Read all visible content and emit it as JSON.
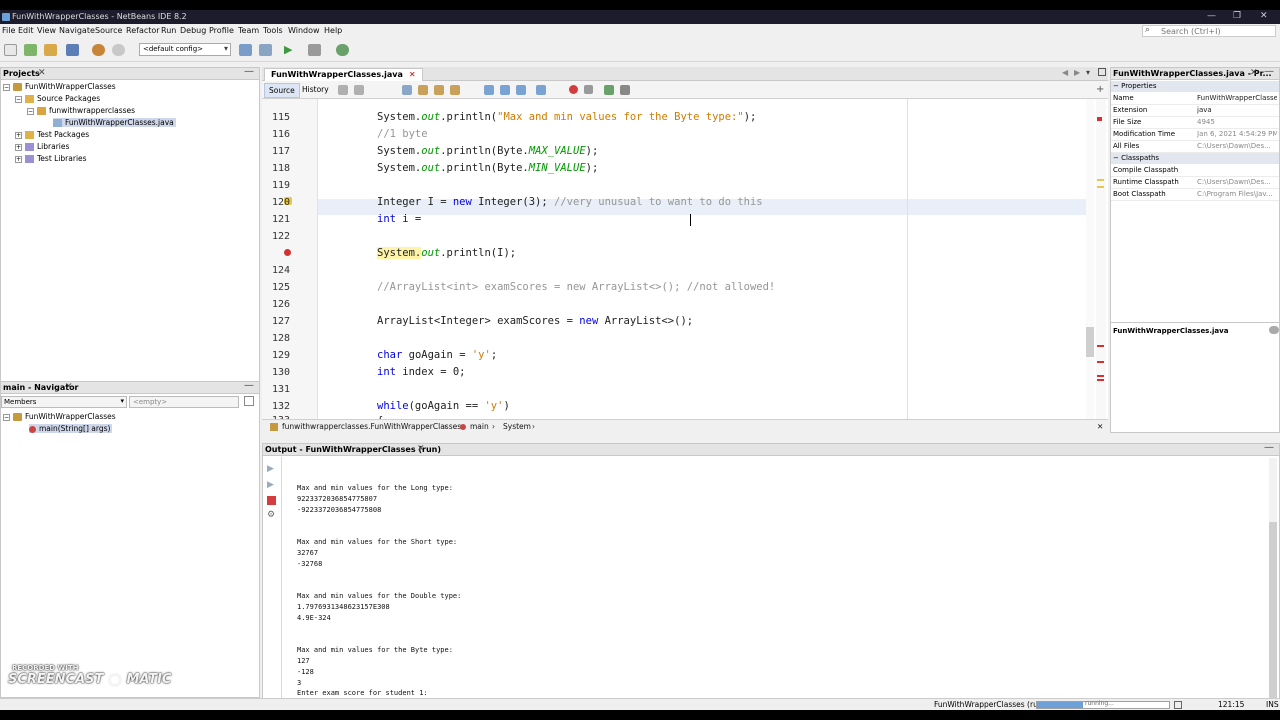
{
  "window": {
    "title": "FunWithWrapperClasses - NetBeans IDE 8.2"
  },
  "menu": [
    "File",
    "Edit",
    "View",
    "Navigate",
    "Source",
    "Refactor",
    "Run",
    "Debug",
    "Profile",
    "Team",
    "Tools",
    "Window",
    "Help"
  ],
  "search": {
    "placeholder": "Search (Ctrl+I)"
  },
  "toolbar": {
    "config": "<default config>"
  },
  "projects": {
    "tab_label": "Projects",
    "tree": [
      {
        "label": "FunWithWrapperClasses",
        "level": 0,
        "icon": "project-icon"
      },
      {
        "label": "Source Packages",
        "level": 1,
        "icon": "folder-icon"
      },
      {
        "label": "funwithwrapperclasses",
        "level": 2,
        "icon": "package-icon"
      },
      {
        "label": "FunWithWrapperClasses.java",
        "level": 3,
        "icon": "java-file-icon"
      },
      {
        "label": "Test Packages",
        "level": 1,
        "icon": "folder-icon"
      },
      {
        "label": "Libraries",
        "level": 1,
        "icon": "library-icon"
      },
      {
        "label": "Test Libraries",
        "level": 1,
        "icon": "library-icon"
      }
    ]
  },
  "navigator": {
    "tab_label": "main - Navigator",
    "filter_label": "Members",
    "filter_placeholder": "<empty>",
    "tree": [
      {
        "label": "FunWithWrapperClasses"
      },
      {
        "label": "main(String[] args)"
      }
    ]
  },
  "editor": {
    "tab_label": "FunWithWrapperClasses.java",
    "source_label": "Source",
    "history_label": "History",
    "lines": [
      {
        "num": "115",
        "p1": "System.",
        "p2": "out",
        "p3": ".println(",
        "p4": "\"Max and min values for the Byte type:\"",
        "p5": ");"
      },
      {
        "num": "116",
        "comment": "//1 byte"
      },
      {
        "num": "117",
        "p1": "System.",
        "p2": "out",
        "p3": ".println(Byte.",
        "p4": "MAX_VALUE",
        "p5": ");"
      },
      {
        "num": "118",
        "p1": "System.",
        "p2": "out",
        "p3": ".println(Byte.",
        "p4": "MIN_VALUE",
        "p5": ");"
      },
      {
        "num": "119"
      },
      {
        "num": "120",
        "p1": "Integer I = ",
        "p2": "new",
        "p3": " Integer(3); ",
        "p4": "//very unusual to want to do this"
      },
      {
        "num": "121",
        "p1": "int",
        "p2": " i ="
      },
      {
        "num": "122"
      },
      {
        "num": "",
        "p1": "System.",
        "p2": "out",
        "p3": ".println(I);"
      },
      {
        "num": "124"
      },
      {
        "num": "125",
        "comment": "//ArrayList<int> examScores = new ArrayList<>(); //not allowed!"
      },
      {
        "num": "126"
      },
      {
        "num": "127",
        "p1": "ArrayList<Integer> examScores = ",
        "p2": "new",
        "p3": " ArrayList<>();"
      },
      {
        "num": "128"
      },
      {
        "num": "129",
        "p1": "char",
        "p2": " goAgain = ",
        "p3": "'y'",
        "p4": ";"
      },
      {
        "num": "130",
        "p1": "int",
        "p2": " index = 0;"
      },
      {
        "num": "131"
      },
      {
        "num": "132",
        "p1": "while",
        "p2": "(goAgain == ",
        "p3": "'y'",
        "p4": ")"
      },
      {
        "num": "133",
        "p1": "{"
      }
    ]
  },
  "breadcrumb": [
    "funwithwrapperclasses.FunWithWrapperClasses",
    "main",
    "System"
  ],
  "properties": {
    "tab_label": "FunWithWrapperClasses.java - Pr...",
    "section1": "Properties",
    "rows": [
      {
        "k": "Name",
        "v": "FunWithWrapperClasses"
      },
      {
        "k": "Extension",
        "v": "java"
      },
      {
        "k": "File Size",
        "v": "4945"
      },
      {
        "k": "Modification Time",
        "v": "Jan 6, 2021 4:54:29 PM"
      },
      {
        "k": "All Files",
        "v": "C:\\Users\\Dawn\\Des..."
      }
    ],
    "section2": "Classpaths",
    "rows2": [
      {
        "k": "Compile Classpath",
        "v": ""
      },
      {
        "k": "Runtime Classpath",
        "v": "C:\\Users\\Dawn\\Des..."
      },
      {
        "k": "Boot Classpath",
        "v": "C:\\Program Files\\Jav..."
      }
    ],
    "footer": "FunWithWrapperClasses.java"
  },
  "output": {
    "tab_label": "Output - FunWithWrapperClasses (run)",
    "lines": [
      "Max and min values for the Long type:",
      "9223372036854775807",
      "-9223372036854775808",
      "",
      "",
      "Max and min values for the Short type:",
      "32767",
      "-32768",
      "",
      "",
      "Max and min values for the Double type:",
      "1.7976931348623157E308",
      "4.9E-324",
      "",
      "",
      "Max and min values for the Byte type:",
      "127",
      "-128",
      "3",
      "Enter exam score for student 1:"
    ]
  },
  "status": {
    "task": "FunWithWrapperClasses (run)",
    "progress_label": "running...",
    "progress": 0.35,
    "position": "121:15",
    "mode": "INS"
  },
  "watermark": {
    "line1": "RECORDED WITH",
    "line2": "SCREENCAST",
    "line3": "MATIC"
  }
}
